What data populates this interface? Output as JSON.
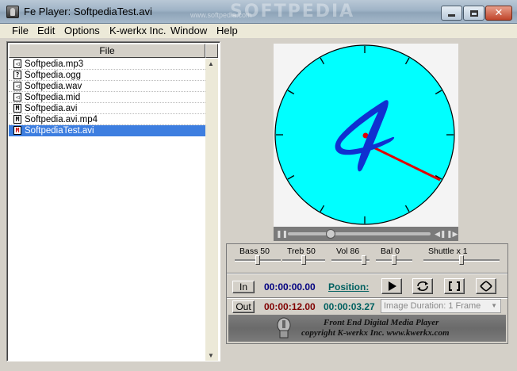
{
  "window": {
    "title": "Fe Player: SoftpediaTest.avi",
    "watermark": "SOFTPEDIA",
    "watermark_sub": "www.softpedia.com"
  },
  "menu": [
    "File",
    "Edit",
    "Options",
    "K-werkx Inc.",
    "Window",
    "Help"
  ],
  "playlist": {
    "column_header": "File",
    "files": [
      {
        "name": "Softpedia.mp3",
        "icon": "speaker-icon",
        "glyph": "◁"
      },
      {
        "name": "Softpedia.ogg",
        "icon": "unknown-file-icon",
        "glyph": "?"
      },
      {
        "name": "Softpedia.wav",
        "icon": "speaker-icon",
        "glyph": "◁"
      },
      {
        "name": "Softpedia.mid",
        "icon": "speaker-icon",
        "glyph": "◁"
      },
      {
        "name": "Softpedia.avi",
        "icon": "movie-icon",
        "glyph": "M"
      },
      {
        "name": "Softpedia.avi.mp4",
        "icon": "movie-icon",
        "glyph": "M"
      },
      {
        "name": "SoftpediaTest.avi",
        "icon": "movie-icon",
        "glyph": "M",
        "selected": true
      }
    ]
  },
  "video": {
    "clock_face_color": "#00ffff",
    "digit": "4",
    "seek_position": 0.3
  },
  "sliders": [
    {
      "label": "Bass 50",
      "value": 0.5
    },
    {
      "label": "Treb 50",
      "value": 0.5
    },
    {
      "label": "Vol 86",
      "value": 0.86
    },
    {
      "label": "Bal 0",
      "value": 0.5
    },
    {
      "label": "Shuttle x 1",
      "value": 0.5
    }
  ],
  "transport": {
    "in_label": "In",
    "out_label": "Out",
    "in_time": "00:00:00.00",
    "out_time": "00:00:12.00",
    "position_label": "Position:",
    "position_time": "00:00:03.27",
    "image_duration": "Image Duration: 1 Frame",
    "in_time_color": "#000080",
    "out_time_color": "#800000",
    "position_time_color": "#006060"
  },
  "banner": {
    "line1": "Front End Digital Media Player",
    "line2": "copyright K-werkx Inc. www.kwerkx.com"
  }
}
